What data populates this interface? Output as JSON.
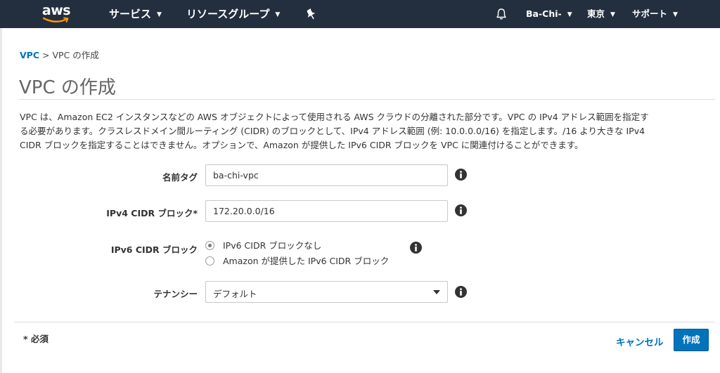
{
  "nav": {
    "logo_text": "aws",
    "services_label": "サービス",
    "resource_groups_label": "リソースグループ",
    "pin_icon": "pin-icon",
    "bell_icon": "bell-icon",
    "account_label": "Ba-Chi-",
    "region_label": "東京",
    "support_label": "サポート"
  },
  "breadcrumb": {
    "root": "VPC",
    "separator": ">",
    "current": "VPC の作成"
  },
  "page": {
    "title": "VPC の作成",
    "description_lines": [
      "VPC は、Amazon EC2 インスタンスなどの AWS オブジェクトによって使用される AWS クラウドの分離された部分です。VPC の IPv4 アドレス範囲を指定す",
      "る必要があります。クラスレスドメイン間ルーティング (CIDR) のブロックとして、IPv4 アドレス範囲 (例: 10.0.0.0/16) を指定します。/16 より大きな IPv4",
      "CIDR ブロックを指定することはできません。オプションで、Amazon が提供した IPv6 CIDR ブロックを VPC に関連付けることができます。"
    ]
  },
  "form": {
    "name_tag": {
      "label": "名前タグ",
      "value": "ba-chi-vpc"
    },
    "ipv4_cidr": {
      "label": "IPv4 CIDR ブロック*",
      "value": "172.20.0.0/16"
    },
    "ipv6_cidr": {
      "label": "IPv6 CIDR ブロック",
      "options": [
        "IPv6 CIDR ブロックなし",
        "Amazon が提供した IPv6 CIDR ブロック"
      ],
      "selected_index": 0
    },
    "tenancy": {
      "label": "テナンシー",
      "selected": "デフォルト"
    }
  },
  "footer": {
    "required_note": "* 必須",
    "cancel_label": "キャンセル",
    "create_label": "作成"
  },
  "colors": {
    "nav_bg": "#232f3e",
    "link_blue": "#0073bb",
    "button_blue": "#0073bb",
    "smile_orange": "#ff9900"
  }
}
